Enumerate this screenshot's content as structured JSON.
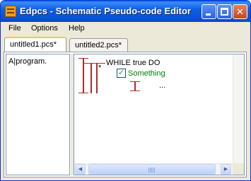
{
  "window": {
    "title": "Edpcs - Schematic Pseudo-code Editor",
    "buttons": {
      "minimize_icon": "minimize-icon",
      "maximize_icon": "maximize-icon",
      "close_label": "✕"
    }
  },
  "menubar": {
    "items": [
      "File",
      "Options",
      "Help"
    ]
  },
  "tabs": [
    {
      "label": "untitled1.pcs*",
      "active": true
    },
    {
      "label": "untitled2.pcs*",
      "active": false
    }
  ],
  "editor": {
    "code_text": "A|program."
  },
  "diagram": {
    "while_label": "WHILE true DO",
    "star": "*",
    "check_mark": "✓",
    "statement": "Something",
    "ellipsis": "...",
    "colors": {
      "structure": "#b02a2a",
      "statement": "#008000"
    }
  },
  "scrollbars": {
    "left_arrow": "◀",
    "right_arrow": "▶"
  }
}
